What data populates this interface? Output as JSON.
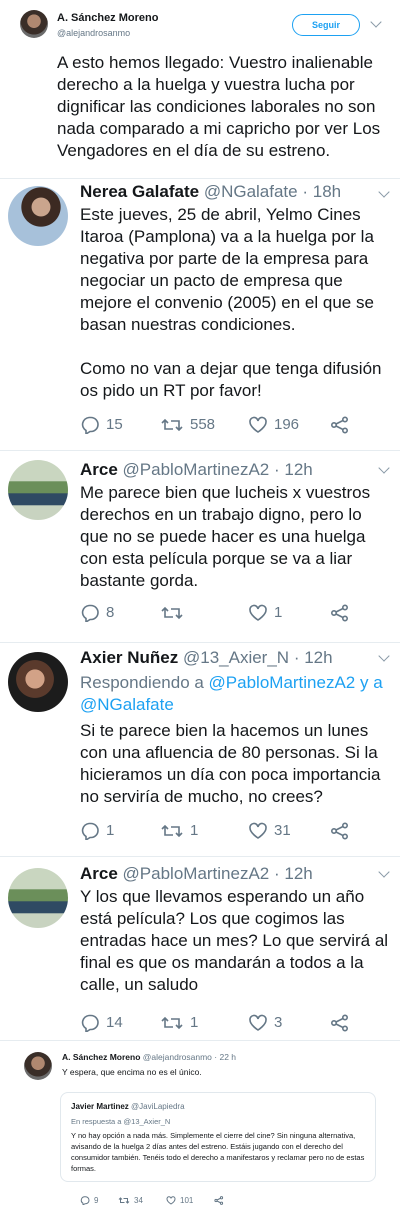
{
  "original": {
    "name": "A. Sánchez Moreno",
    "handle": "@alejandrosanmo",
    "follow_label": "Seguir",
    "text": "A esto hemos llegado: Vuestro inalienable derecho a la huelga y vuestra lucha por dignificar las condiciones laborales no son nada comparado a mi capricho por ver Los Vengadores en el día de su estreno."
  },
  "replies": [
    {
      "name": "Nerea Galafate",
      "handle": "@NGalafate",
      "time": "· 18h",
      "text1": "Este jueves, 25 de abril, Yelmo Cines Itaroa (Pamplona) va a la huelga por la negativa por parte de la empresa para negociar un pacto de empresa que mejore el convenio (2005) en el que se basan nuestras condiciones.",
      "text2": "Como no van a dejar que tenga difusión os pido un RT por favor!",
      "replies": "15",
      "retweets": "558",
      "likes": "196"
    },
    {
      "name": "Arce",
      "handle": "@PabloMartinezA2",
      "time": "· 12h",
      "text1": "Me parece bien que lucheis x vuestros derechos en un trabajo digno, pero lo que no se puede hacer es una huelga con esta película porque se va a liar bastante gorda.",
      "replies": "8",
      "retweets": "",
      "likes": "1"
    },
    {
      "name": "Axier Nuñez",
      "handle": "@13_Axier_N",
      "time": "· 12h",
      "replying_prefix": "Respondiendo a ",
      "replying_to": "@PabloMartinezA2 y a @NGalafate",
      "text1": "Si te parece bien la hacemos un lunes con una afluencia de 80 personas. Si la hicieramos un día con poca importancia no serviría de mucho, no crees?",
      "replies": "1",
      "retweets": "1",
      "likes": "31"
    },
    {
      "name": "Arce",
      "handle": "@PabloMartinezA2",
      "time": "· 12h",
      "text1": "Y los que llevamos esperando un año está película? Los que cogimos las entradas hace un mes? Lo que servirá al final es que os mandarán a todos a la calle, un saludo",
      "replies": "14",
      "retweets": "1",
      "likes": "3"
    }
  ],
  "bottom": {
    "name": "A. Sánchez Moreno",
    "handle": "@alejandrosanmo",
    "time": "· 22 h",
    "text": "Y espera, que encima no es el único.",
    "quote": {
      "name": "Javier Martinez",
      "handle": "@JaviLapiedra",
      "replying": "En respuesta a @13_Axier_N",
      "text": "Y no hay opción a nada más. Simplemente el cierre del cine? Sin ninguna alternativa, avisando de la huelga 2 días antes del estreno. Estáis jugando con el derecho del consumidor también. Tenéis todo el derecho a manifestaros y reclamar pero no de estas formas."
    },
    "replies": "9",
    "retweets": "34",
    "likes": "101"
  },
  "colors": {
    "accent": "#1da1f2",
    "muted": "#657786",
    "text": "#14171a",
    "divider": "#e6ecf0"
  }
}
